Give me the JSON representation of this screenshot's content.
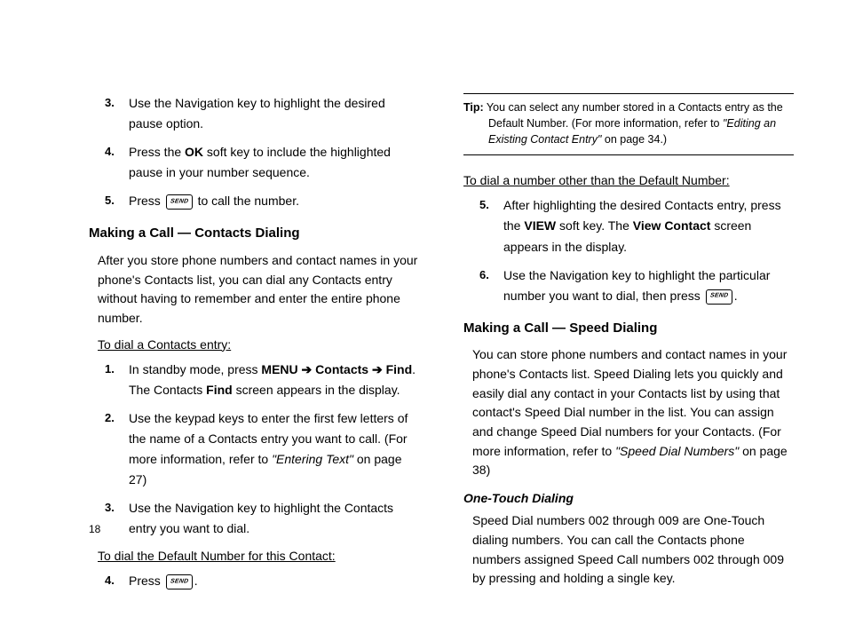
{
  "left": {
    "steps_top": [
      {
        "num": "3",
        "text": "Use the Navigation key to highlight the desired pause option."
      },
      {
        "num": "4",
        "pre": "Press the ",
        "bold1": "OK",
        "post1": " soft key to include the highlighted pause in your number sequence."
      },
      {
        "num": "5",
        "pre": "Press ",
        "icon": true,
        "post": " to call the number."
      }
    ],
    "heading1": "Making a Call — Contacts Dialing",
    "para1": "After you store phone numbers and contact names in your phone's Contacts list, you can dial any Contacts entry without having to remember and enter the entire phone number.",
    "subhead1": "To dial a Contacts entry:",
    "steps_mid": [
      {
        "num": "1",
        "pre": "In standby mode, press ",
        "b1": "MENU",
        "a1": " ➔ ",
        "b2": "Contacts",
        "a2": " ➔ ",
        "b3": "Find",
        "post": ". The Contacts ",
        "b4": "Find",
        "post2": " screen appears in the display."
      },
      {
        "num": "2",
        "pre": "Use the keypad keys to enter the first few letters of the name of a Contacts entry you want to call. (For more information, refer to ",
        "ref": "\"Entering Text\"",
        "post": "  on page 27)"
      },
      {
        "num": "3",
        "text": "Use the Navigation key to highlight the Contacts entry you want to dial."
      }
    ],
    "subhead2": "To dial the Default Number for this Contact:",
    "steps_bot": [
      {
        "num": "4",
        "pre": "Press ",
        "icon": true,
        "post": "."
      }
    ]
  },
  "right": {
    "tip_label": "Tip:",
    "tip_text1": " You can select any number stored in a Contacts entry as the Default Number. (For more information, refer to ",
    "tip_ref": "\"Editing an Existing Contact Entry\"",
    "tip_text2": "  on page 34.)",
    "subhead1": "To dial a number other than the Default Number:",
    "steps": [
      {
        "num": "5",
        "pre": "After highlighting the desired Contacts entry, press the ",
        "b1": "VIEW",
        "mid": " soft key. The ",
        "b2": "View Contact",
        "post": " screen appears in the display."
      },
      {
        "num": "6",
        "pre": "Use the Navigation key to highlight the particular number you want to dial, then press ",
        "icon": true,
        "post": "."
      }
    ],
    "heading1": "Making a Call — Speed Dialing",
    "para1_a": "You can store phone numbers and contact names in your phone's Contacts list. Speed Dialing lets you quickly and easily dial any contact in your Contacts list by using that contact's Speed Dial number in the list. You can assign and change Speed Dial numbers for your Contacts. (For more information, refer to ",
    "para1_ref": "\"Speed Dial Numbers\"",
    "para1_b": "  on page 38)",
    "subheading2": "One-Touch Dialing",
    "para2": "Speed Dial numbers 002 through 009 are One-Touch dialing numbers. You can call the Contacts phone numbers assigned Speed Call numbers 002 through 009 by pressing and holding a single key."
  },
  "page_number": "18"
}
